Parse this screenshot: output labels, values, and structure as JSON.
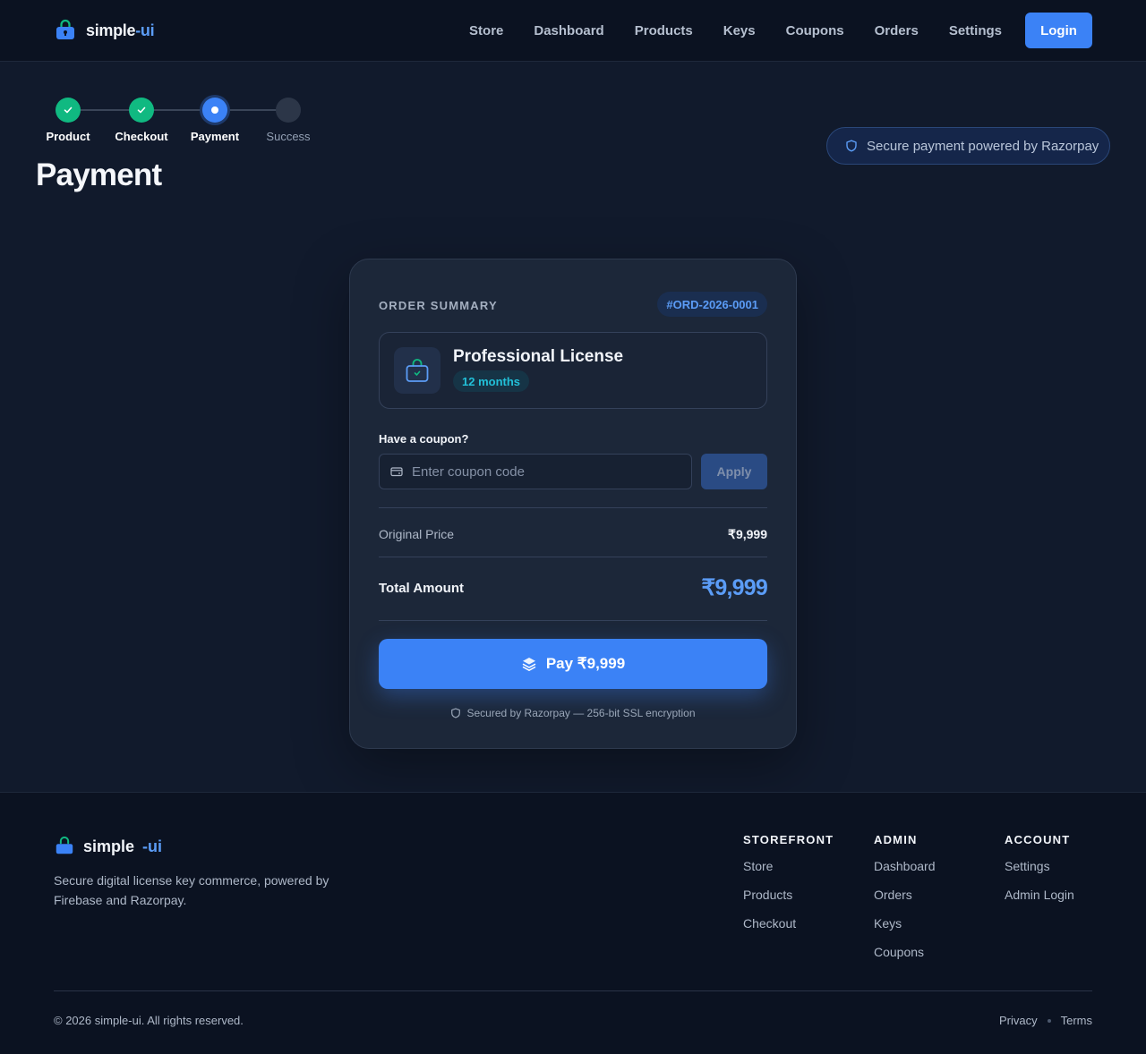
{
  "brand": {
    "name": "simple",
    "accent": "-ui",
    "logo_icon": "lock-bag-icon"
  },
  "nav": {
    "items": [
      "Store",
      "Dashboard",
      "Products",
      "Keys",
      "Coupons",
      "Orders",
      "Settings"
    ],
    "login_label": "Login"
  },
  "stepper": {
    "steps": [
      {
        "label": "Product",
        "state": "done"
      },
      {
        "label": "Checkout",
        "state": "done"
      },
      {
        "label": "Payment",
        "state": "active"
      },
      {
        "label": "Success",
        "state": "pending"
      }
    ]
  },
  "page": {
    "title": "Payment",
    "secure_badge": "Secure payment powered by Razorpay"
  },
  "order": {
    "summary_label": "ORDER SUMMARY",
    "id": "#ORD-2026-0001",
    "product_name": "Professional License",
    "duration": "12 months",
    "coupon_label": "Have a coupon?",
    "coupon_placeholder": "Enter coupon code",
    "coupon_value": "",
    "apply_label": "Apply",
    "original_price_label": "Original Price",
    "original_price": "₹9,999",
    "total_label": "Total Amount",
    "total": "₹9,999",
    "pay_label": "Pay ₹9,999",
    "secured_note": "Secured by Razorpay — 256-bit SSL encryption"
  },
  "footer": {
    "brand_name": "simple",
    "brand_accent": "-ui",
    "tagline": "Secure digital license key commerce, powered by Firebase and Razorpay.",
    "columns": [
      {
        "heading": "STOREFRONT",
        "links": [
          "Store",
          "Products",
          "Checkout"
        ]
      },
      {
        "heading": "ADMIN",
        "links": [
          "Dashboard",
          "Orders",
          "Keys",
          "Coupons"
        ]
      },
      {
        "heading": "ACCOUNT",
        "links": [
          "Settings",
          "Admin Login"
        ]
      }
    ],
    "copyright": "© 2026 simple-ui. All rights reserved.",
    "legal": [
      "Privacy",
      "Terms"
    ]
  },
  "colors": {
    "background": "#111a2c",
    "header": "#0b1221",
    "accent": "#3b82f6",
    "success": "#10b981",
    "card": "#1c2739"
  }
}
